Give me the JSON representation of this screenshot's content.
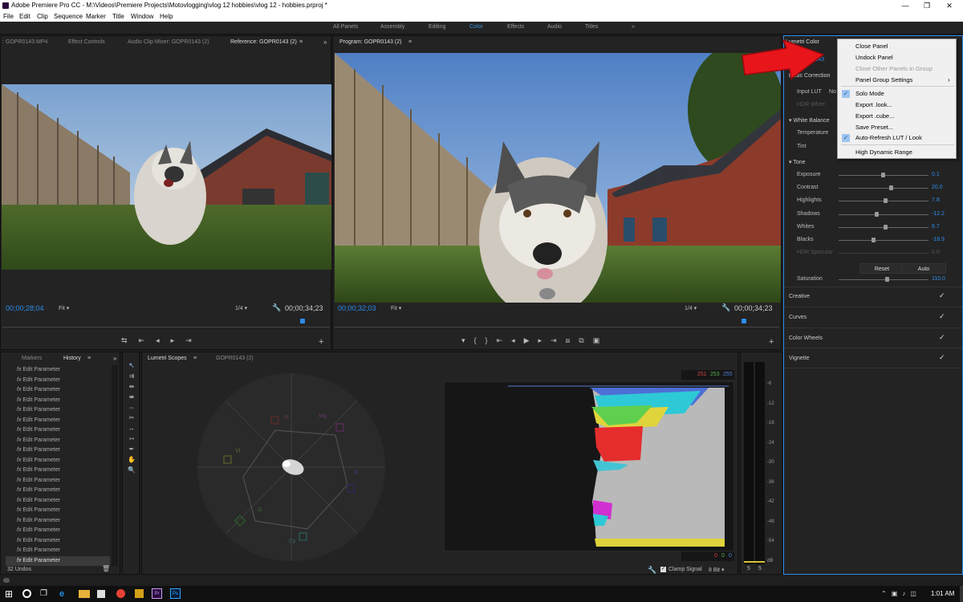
{
  "title": "Adobe Premiere Pro CC - M:\\Videos\\Premiere Projects\\Motovlogging\\vlog 12 hobbies\\vlog 12 - hobbies.prproj *",
  "menu": [
    "File",
    "Edit",
    "Clip",
    "Sequence",
    "Marker",
    "Title",
    "Window",
    "Help"
  ],
  "workspaces": [
    "All Panels",
    "Assembly",
    "Editing",
    "Color",
    "Effects",
    "Audio",
    "Titles"
  ],
  "workspace_active": "Color",
  "source_tabs": [
    ": GOPR0143.MP4",
    "Effect Controls",
    "Audio Clip Mixer: GOPR0143 (2)",
    "Reference: GOPR0143 (2)"
  ],
  "reference": {
    "timecode_left": "00;00;28;04",
    "fit": "Fit",
    "ratio": "1/4",
    "timecode_right": "00;00;34;23"
  },
  "program": {
    "tab": "Program: GOPR0143 (2)",
    "timecode_left": "00;00;32;03",
    "fit": "Fit",
    "ratio": "1/4",
    "timecode_right": "00;00;34;23"
  },
  "lumetri": {
    "tab": "Lumetri Color",
    "clip": "GOPR0143",
    "basic_correction": "Basic Correction",
    "input_lut_label": "Input LUT",
    "input_lut_value": "No",
    "hdr_white": "HDR White",
    "white_balance": "White Balance",
    "temperature": "Temperature",
    "tint": "Tint",
    "tone": "Tone",
    "sliders": [
      {
        "label": "Exposure",
        "value": "0.1"
      },
      {
        "label": "Contrast",
        "value": "20.0"
      },
      {
        "label": "Highlights",
        "value": "7.8"
      },
      {
        "label": "Shadows",
        "value": "-12.2"
      },
      {
        "label": "Whites",
        "value": "6.7"
      },
      {
        "label": "Blacks",
        "value": "-18.9"
      },
      {
        "label": "HDR Specular",
        "value": "0.0"
      }
    ],
    "reset": "Reset",
    "auto": "Auto",
    "saturation_label": "Saturation",
    "saturation_value": "110.0",
    "sections": [
      "Creative",
      "Curves",
      "Color Wheels",
      "Vignette"
    ]
  },
  "context_menu": {
    "items": [
      {
        "label": "Close Panel",
        "checked": false,
        "disabled": false
      },
      {
        "label": "Undock Panel",
        "checked": false,
        "disabled": false
      },
      {
        "label": "Close Other Panels in Group",
        "checked": false,
        "disabled": true
      },
      {
        "label": "Panel Group Settings",
        "checked": false,
        "disabled": false
      },
      {
        "label": "Solo Mode",
        "checked": true,
        "disabled": false
      },
      {
        "label": "Export .look...",
        "checked": false,
        "disabled": false
      },
      {
        "label": "Export .cube...",
        "checked": false,
        "disabled": false
      },
      {
        "label": "Save Preset...",
        "checked": false,
        "disabled": false
      },
      {
        "label": "Auto-Refresh LUT / Look",
        "checked": true,
        "disabled": false
      },
      {
        "label": "High Dynamic Range",
        "checked": false,
        "disabled": false
      }
    ]
  },
  "history": {
    "tabs": [
      "Markers",
      "History"
    ],
    "item_label": "Edit Parameter",
    "item_count": 20,
    "undos": "32 Undos"
  },
  "scopes": {
    "tabs": [
      "Lumetri Scopes",
      "GOPR0143 (2)"
    ],
    "vectorscope_labels": [
      "R",
      "Mg",
      "B",
      "Cy",
      "G",
      "Yl"
    ],
    "rgb_top": [
      "251",
      "253",
      "255"
    ],
    "rgb_bottom": [
      "0",
      "0",
      "0"
    ],
    "clamp_signal": "Clamp Signal",
    "bit_depth": "8 Bit",
    "db_scale": [
      "-6",
      "-12",
      "-18",
      "-24",
      "-30",
      "-36",
      "-42",
      "-48",
      "-54",
      "dB"
    ],
    "meter_values": [
      "5",
      "5"
    ]
  },
  "taskbar": {
    "time": "1:01 AM"
  },
  "colors": {
    "accent": "#2d8ceb",
    "arrow": "#e8151b",
    "panel": "#232323"
  }
}
